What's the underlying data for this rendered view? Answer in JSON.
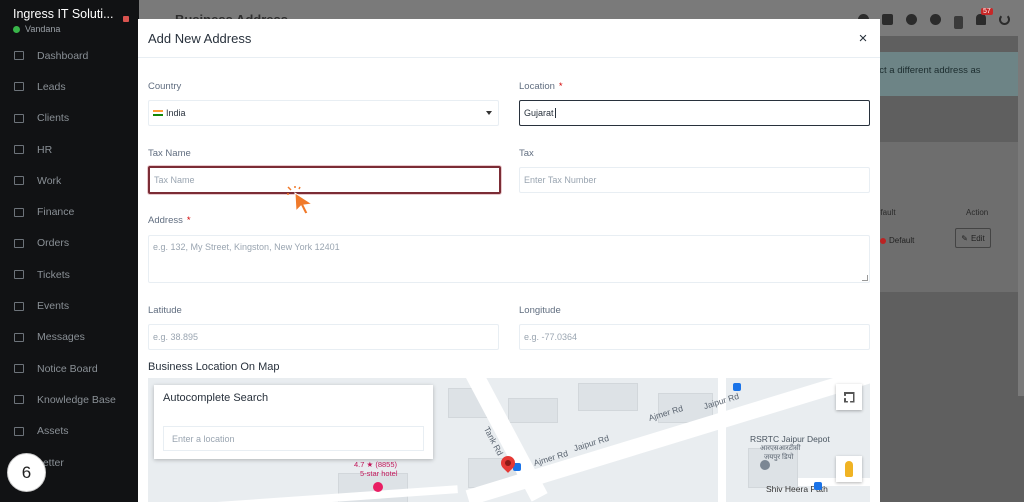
{
  "sidebar": {
    "brand": "Ingress IT Soluti...",
    "user": "Vandana",
    "items": [
      {
        "label": "Dashboard",
        "icon": "home-icon"
      },
      {
        "label": "Leads",
        "icon": "id-card-icon"
      },
      {
        "label": "Clients",
        "icon": "bar-chart-icon"
      },
      {
        "label": "HR",
        "icon": "people-icon"
      },
      {
        "label": "Work",
        "icon": "briefcase-icon"
      },
      {
        "label": "Finance",
        "icon": "dollar-icon"
      },
      {
        "label": "Orders",
        "icon": "cart-icon"
      },
      {
        "label": "Tickets",
        "icon": "headset-icon"
      },
      {
        "label": "Events",
        "icon": "calendar-icon"
      },
      {
        "label": "Messages",
        "icon": "chat-icon"
      },
      {
        "label": "Notice Board",
        "icon": "clipboard-icon"
      },
      {
        "label": "Knowledge Base",
        "icon": "book-icon"
      },
      {
        "label": "Assets",
        "icon": "monitor-icon"
      },
      {
        "label": "Letter",
        "icon": "letter-icon"
      }
    ]
  },
  "topbar": {
    "background_title": "Business Address",
    "notification_count": "57"
  },
  "background": {
    "alert_text_line1": "ect a different address as",
    "alert_text_line2": "",
    "col_default": "efault",
    "col_action": "Action",
    "default_label": "Default",
    "edit_label": "Edit"
  },
  "modal": {
    "title": "Add New Address",
    "close": "×",
    "country": {
      "label": "Country",
      "value": "India"
    },
    "location": {
      "label": "Location",
      "required": "*",
      "value": "Gujarat"
    },
    "tax_name": {
      "label": "Tax Name",
      "placeholder": "Tax Name"
    },
    "tax": {
      "label": "Tax",
      "placeholder": "Enter Tax Number"
    },
    "address": {
      "label": "Address",
      "required": "*",
      "placeholder": "e.g. 132, My Street, Kingston, New York 12401"
    },
    "latitude": {
      "label": "Latitude",
      "placeholder": "e.g. 38.895"
    },
    "longitude": {
      "label": "Longitude",
      "placeholder": "e.g. -77.0364"
    },
    "map_section_title": "Business Location On Map",
    "autocomplete": {
      "title": "Autocomplete Search",
      "placeholder": "Enter a location"
    },
    "map_labels": {
      "tank_rd": "Tank Rd",
      "ajmer_rd_1": "Ajmer Rd",
      "jaipur_rd_1": "Jaipur Rd",
      "ajmer_rd_2": "Ajmer Rd",
      "jaipur_rd_2": "Jaipur Rd",
      "rsrtc": "RSRTC Jaipur Depot",
      "rsrtc_hindi": "आरएसआरटीसी",
      "rsrtc_hindi2": "जयपुर डिपो",
      "shiv_heera": "Shiv Heera Path",
      "rating": "4.7 ★ (8855)",
      "hotel": "5-star hotel"
    }
  },
  "step_number": "6",
  "colors": {
    "focus_border": "#7b2c35",
    "sidebar_bg": "#111214",
    "required": "#d30000"
  }
}
